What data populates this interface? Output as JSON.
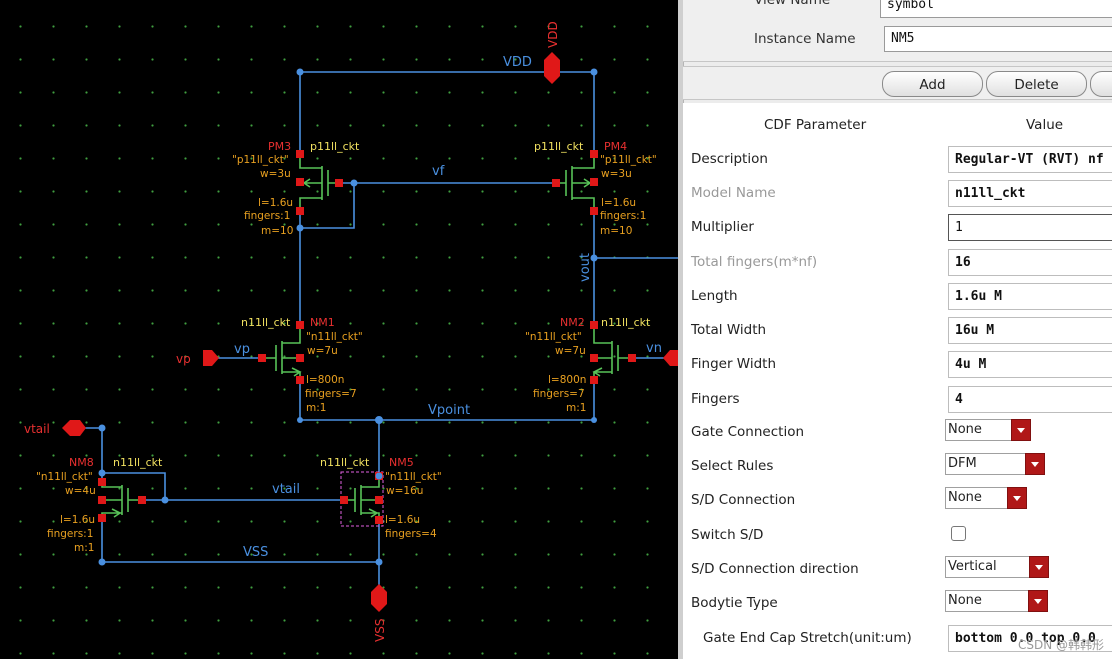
{
  "schematic": {
    "nets": {
      "vdd": "VDD",
      "vf": "vf",
      "vout": "vout",
      "vpoint": "Vpoint",
      "vtail": "vtail",
      "vss": "VSS",
      "vp": "vp",
      "vn": "vn"
    },
    "ports": {
      "vdd": "VDD",
      "vss": "VSS",
      "vp": "vp",
      "vn": "vn",
      "vtail": "vtail"
    },
    "devices": {
      "pm3": {
        "inst": "PM3",
        "cell": "p11ll_ckt",
        "model": "\"p11ll_ckt\"",
        "w": "w=3u",
        "l": "l=1.6u",
        "f": "fingers:1",
        "m": "m=10"
      },
      "pm4": {
        "inst": "PM4",
        "cell": "p11ll_ckt",
        "model": "\"p11ll_ckt\"",
        "w": "w=3u",
        "l": "l=1.6u",
        "f": "fingers:1",
        "m": "m=10"
      },
      "nm1": {
        "inst": "NM1",
        "cell": "n11ll_ckt",
        "model": "\"n11ll_ckt\"",
        "w": "w=7u",
        "l": "l=800n",
        "f": "fingers=7",
        "m": "m:1"
      },
      "nm2": {
        "inst": "NM2",
        "cell": "n11ll_ckt",
        "model": "\"n11ll_ckt\"",
        "w": "w=7u",
        "l": "l=800n",
        "f": "fingers=7",
        "m": "m:1"
      },
      "nm8": {
        "inst": "NM8",
        "cell": "n11ll_ckt",
        "model": "\"n11ll_ckt\"",
        "w": "w=4u",
        "l": "l=1.6u",
        "f": "fingers:1",
        "m": "m:1"
      },
      "nm5": {
        "inst": "NM5",
        "cell": "n11ll_ckt",
        "model": "\"n11ll_ckt\"",
        "w": "w=16u",
        "l": "l=1.6u",
        "f": "fingers=4"
      }
    }
  },
  "panel": {
    "view_name_label": "View Name",
    "view_name_value": "symbol",
    "instance_name_label": "Instance Name",
    "instance_name_value": "NM5",
    "buttons": {
      "add": "Add",
      "delete": "Delete"
    },
    "table_headers": {
      "param": "CDF Parameter",
      "value": "Value"
    },
    "rows": {
      "description": {
        "label": "Description",
        "value": "Regular-VT (RVT) nf"
      },
      "model_name": {
        "label": "Model Name",
        "value": "n11ll_ckt"
      },
      "multiplier": {
        "label": "Multiplier",
        "value": "1"
      },
      "total_fingers": {
        "label": "Total fingers(m*nf)",
        "value": "16"
      },
      "length": {
        "label": "Length",
        "value": "1.6u M"
      },
      "total_width": {
        "label": "Total Width",
        "value": "16u M"
      },
      "finger_width": {
        "label": "Finger Width",
        "value": "4u M"
      },
      "fingers": {
        "label": "Fingers",
        "value": "4"
      },
      "gate_connection": {
        "label": "Gate Connection",
        "value": "None"
      },
      "select_rules": {
        "label": "Select Rules",
        "value": "DFM"
      },
      "sd_connection": {
        "label": "S/D Connection",
        "value": "None"
      },
      "switch_sd": {
        "label": "Switch S/D",
        "checked": false
      },
      "sd_direction": {
        "label": "S/D Connection direction",
        "value": "Vertical"
      },
      "bodytie": {
        "label": "Bodytie Type",
        "value": "None"
      },
      "gate_end_cap": {
        "label": "Gate End Cap Stretch(unit:um)",
        "value": "bottom 0.0 top 0.0"
      }
    },
    "watermark": "CSDN @韩韩形"
  },
  "colors": {
    "wire": "#4a90e0",
    "device": "#58c258",
    "pin": "#e01818",
    "params": "#e8a020",
    "cell": "#f0e060",
    "combo_arrow": "#b01818"
  }
}
